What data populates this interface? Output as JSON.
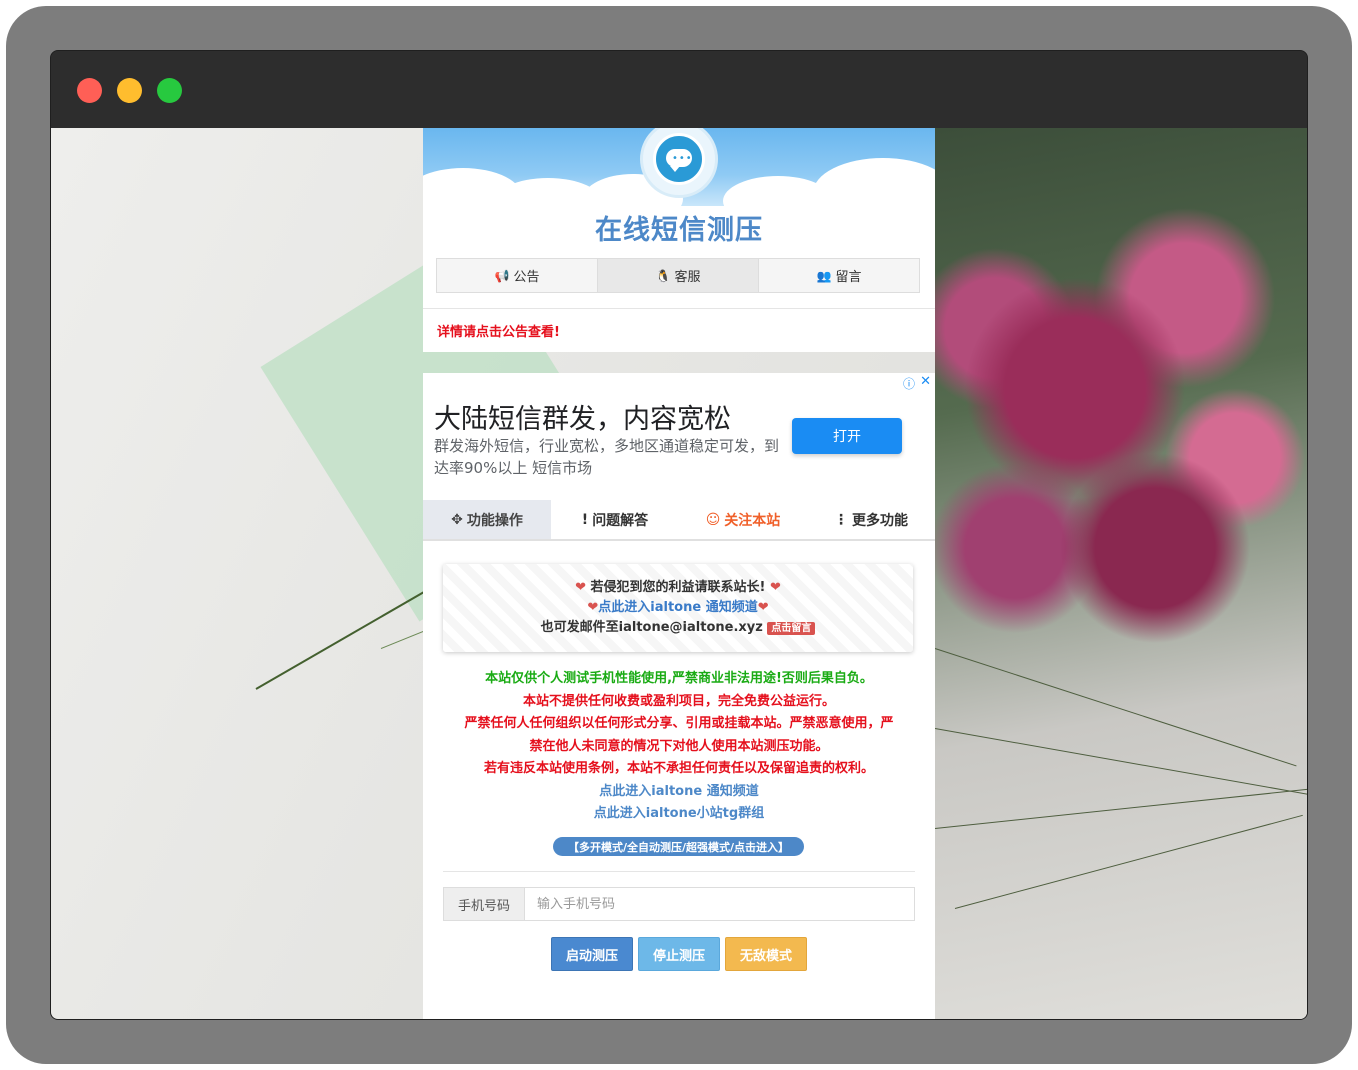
{
  "window": {
    "buttons": [
      "close",
      "minimize",
      "maximize"
    ]
  },
  "header": {
    "site_title": "在线短信测压",
    "nav": [
      {
        "icon": "megaphone-icon",
        "label": "公告"
      },
      {
        "icon": "qq-icon",
        "label": "客服"
      },
      {
        "icon": "users-icon",
        "label": "留言"
      }
    ],
    "notice": "详情请点击公告查看!"
  },
  "ad": {
    "title": "大陆短信群发，内容宽松",
    "description": "群发海外短信，行业宽松，多地区通道稳定可发，到达率90%以上 短信市场",
    "button": "打开",
    "info_icon": "ⓘ",
    "close_icon": "✕"
  },
  "tabs": [
    {
      "icon": "✥",
      "label": "功能操作"
    },
    {
      "icon": "!",
      "label": "问题解答"
    },
    {
      "icon": "☺",
      "label": "关注本站"
    },
    {
      "icon": "⋮",
      "label": "更多功能"
    }
  ],
  "contact": {
    "line1": "若侵犯到您的利益请联系站长!",
    "line2": "点此进入ialtone 通知频道",
    "line3": "也可发邮件至ialtone@ialtone.xyz",
    "line3_badge": "点击留言"
  },
  "rules": {
    "line1": "本站仅供个人测试手机性能使用,严禁商业非法用途!否则后果自负。",
    "line2": "本站不提供任何收费或盈利项目，完全免费公益运行。",
    "line3": "严禁任何人任何组织以任何形式分享、引用或挂载本站。严禁恶意使用，严",
    "line4": "禁在他人未同意的情况下对他人使用本站测压功能。",
    "line5": "若有违反本站使用条例，本站不承担任何责任以及保留追责的权利。",
    "link1": "点此进入ialtone 通知频道",
    "link2": "点此进入ialtone小站tg群组"
  },
  "mode_badge": "【多开模式/全自动测压/超强模式/点击进入】",
  "form": {
    "phone_label": "手机号码",
    "phone_placeholder": "输入手机号码",
    "phone_value": "",
    "start": "启动测压",
    "stop": "停止测压",
    "invincible": "无敌模式"
  },
  "colors": {
    "title_blue": "#4d88c8",
    "notice_red": "#e5101d",
    "rule_green": "#1aab14",
    "ad_button": "#1a8cf3"
  }
}
